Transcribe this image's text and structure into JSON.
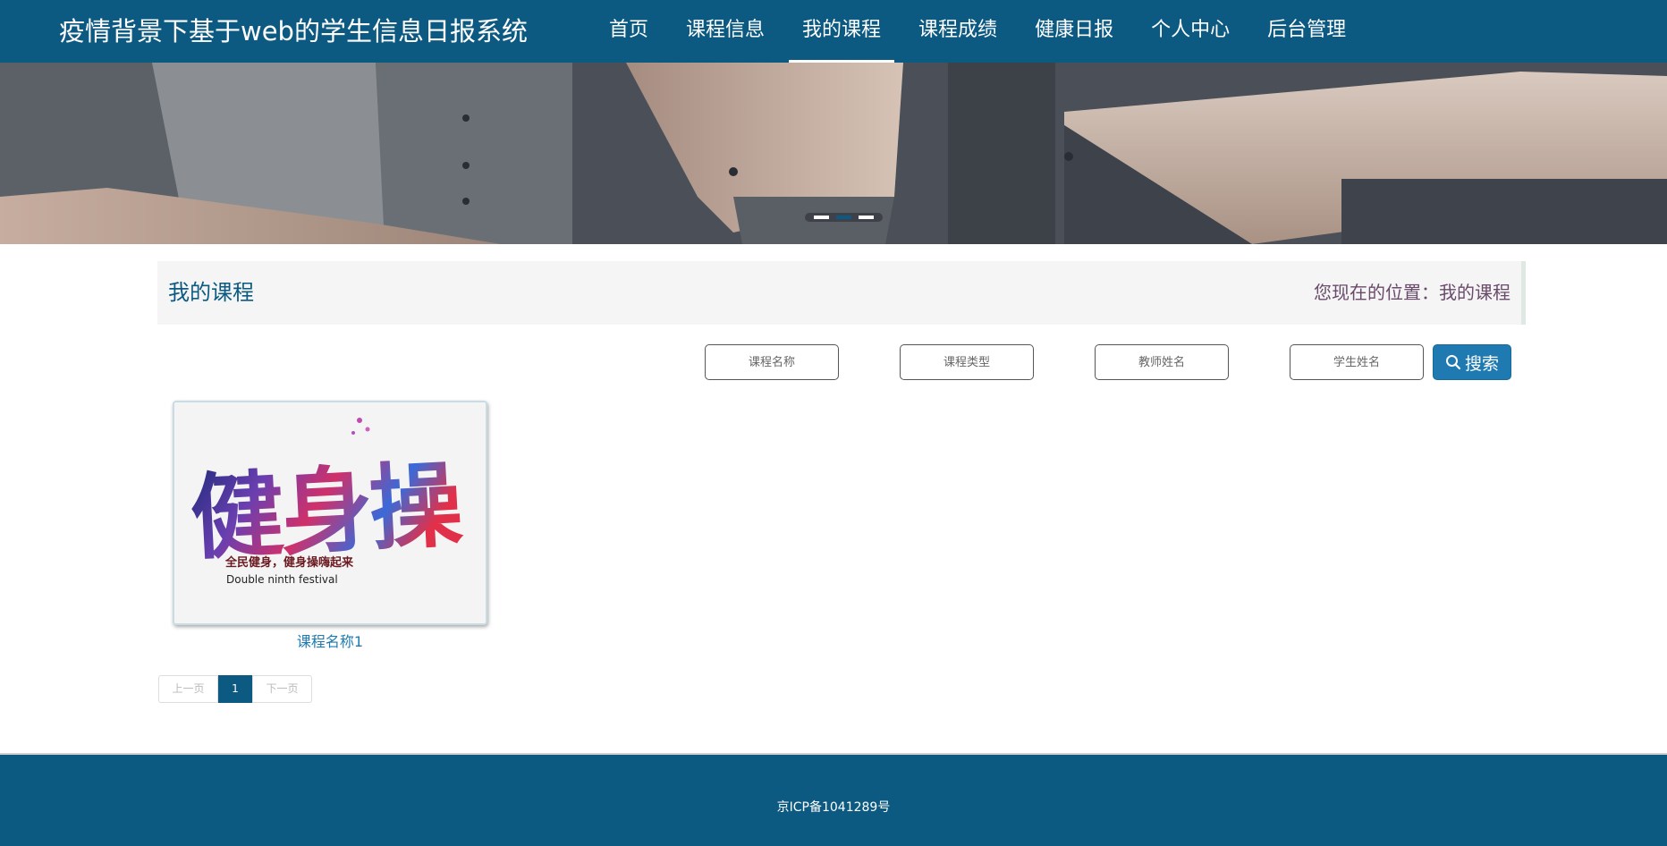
{
  "header": {
    "site_title": "疫情背景下基于web的学生信息日报系统",
    "nav": [
      {
        "label": "首页",
        "active": false
      },
      {
        "label": "课程信息",
        "active": false
      },
      {
        "label": "我的课程",
        "active": true
      },
      {
        "label": "课程成绩",
        "active": false
      },
      {
        "label": "健康日报",
        "active": false
      },
      {
        "label": "个人中心",
        "active": false
      },
      {
        "label": "后台管理",
        "active": false
      }
    ]
  },
  "banner": {
    "slide_count": 3,
    "active_slide": 2
  },
  "section": {
    "title": "我的课程",
    "breadcrumb_prefix": "您现在的位置：",
    "breadcrumb_current": "我的课程"
  },
  "search": {
    "course_name_placeholder": "课程名称",
    "course_type_placeholder": "课程类型",
    "teacher_name_placeholder": "教师姓名",
    "student_name_placeholder": "学生姓名",
    "button_label": "搜索"
  },
  "courses": [
    {
      "name": "课程名称1",
      "image_text": "健身操",
      "image_subtitle": "全民健身，健身操嗨起来",
      "image_caption": "Double ninth festival"
    }
  ],
  "pagination": {
    "prev_label": "上一页",
    "current_page": "1",
    "next_label": "下一页"
  },
  "footer": {
    "icp": "京ICP备1041289号"
  },
  "colors": {
    "primary": "#0c5a82",
    "accent": "#1e7ab0",
    "breadcrumb": "#6a4a6a"
  }
}
